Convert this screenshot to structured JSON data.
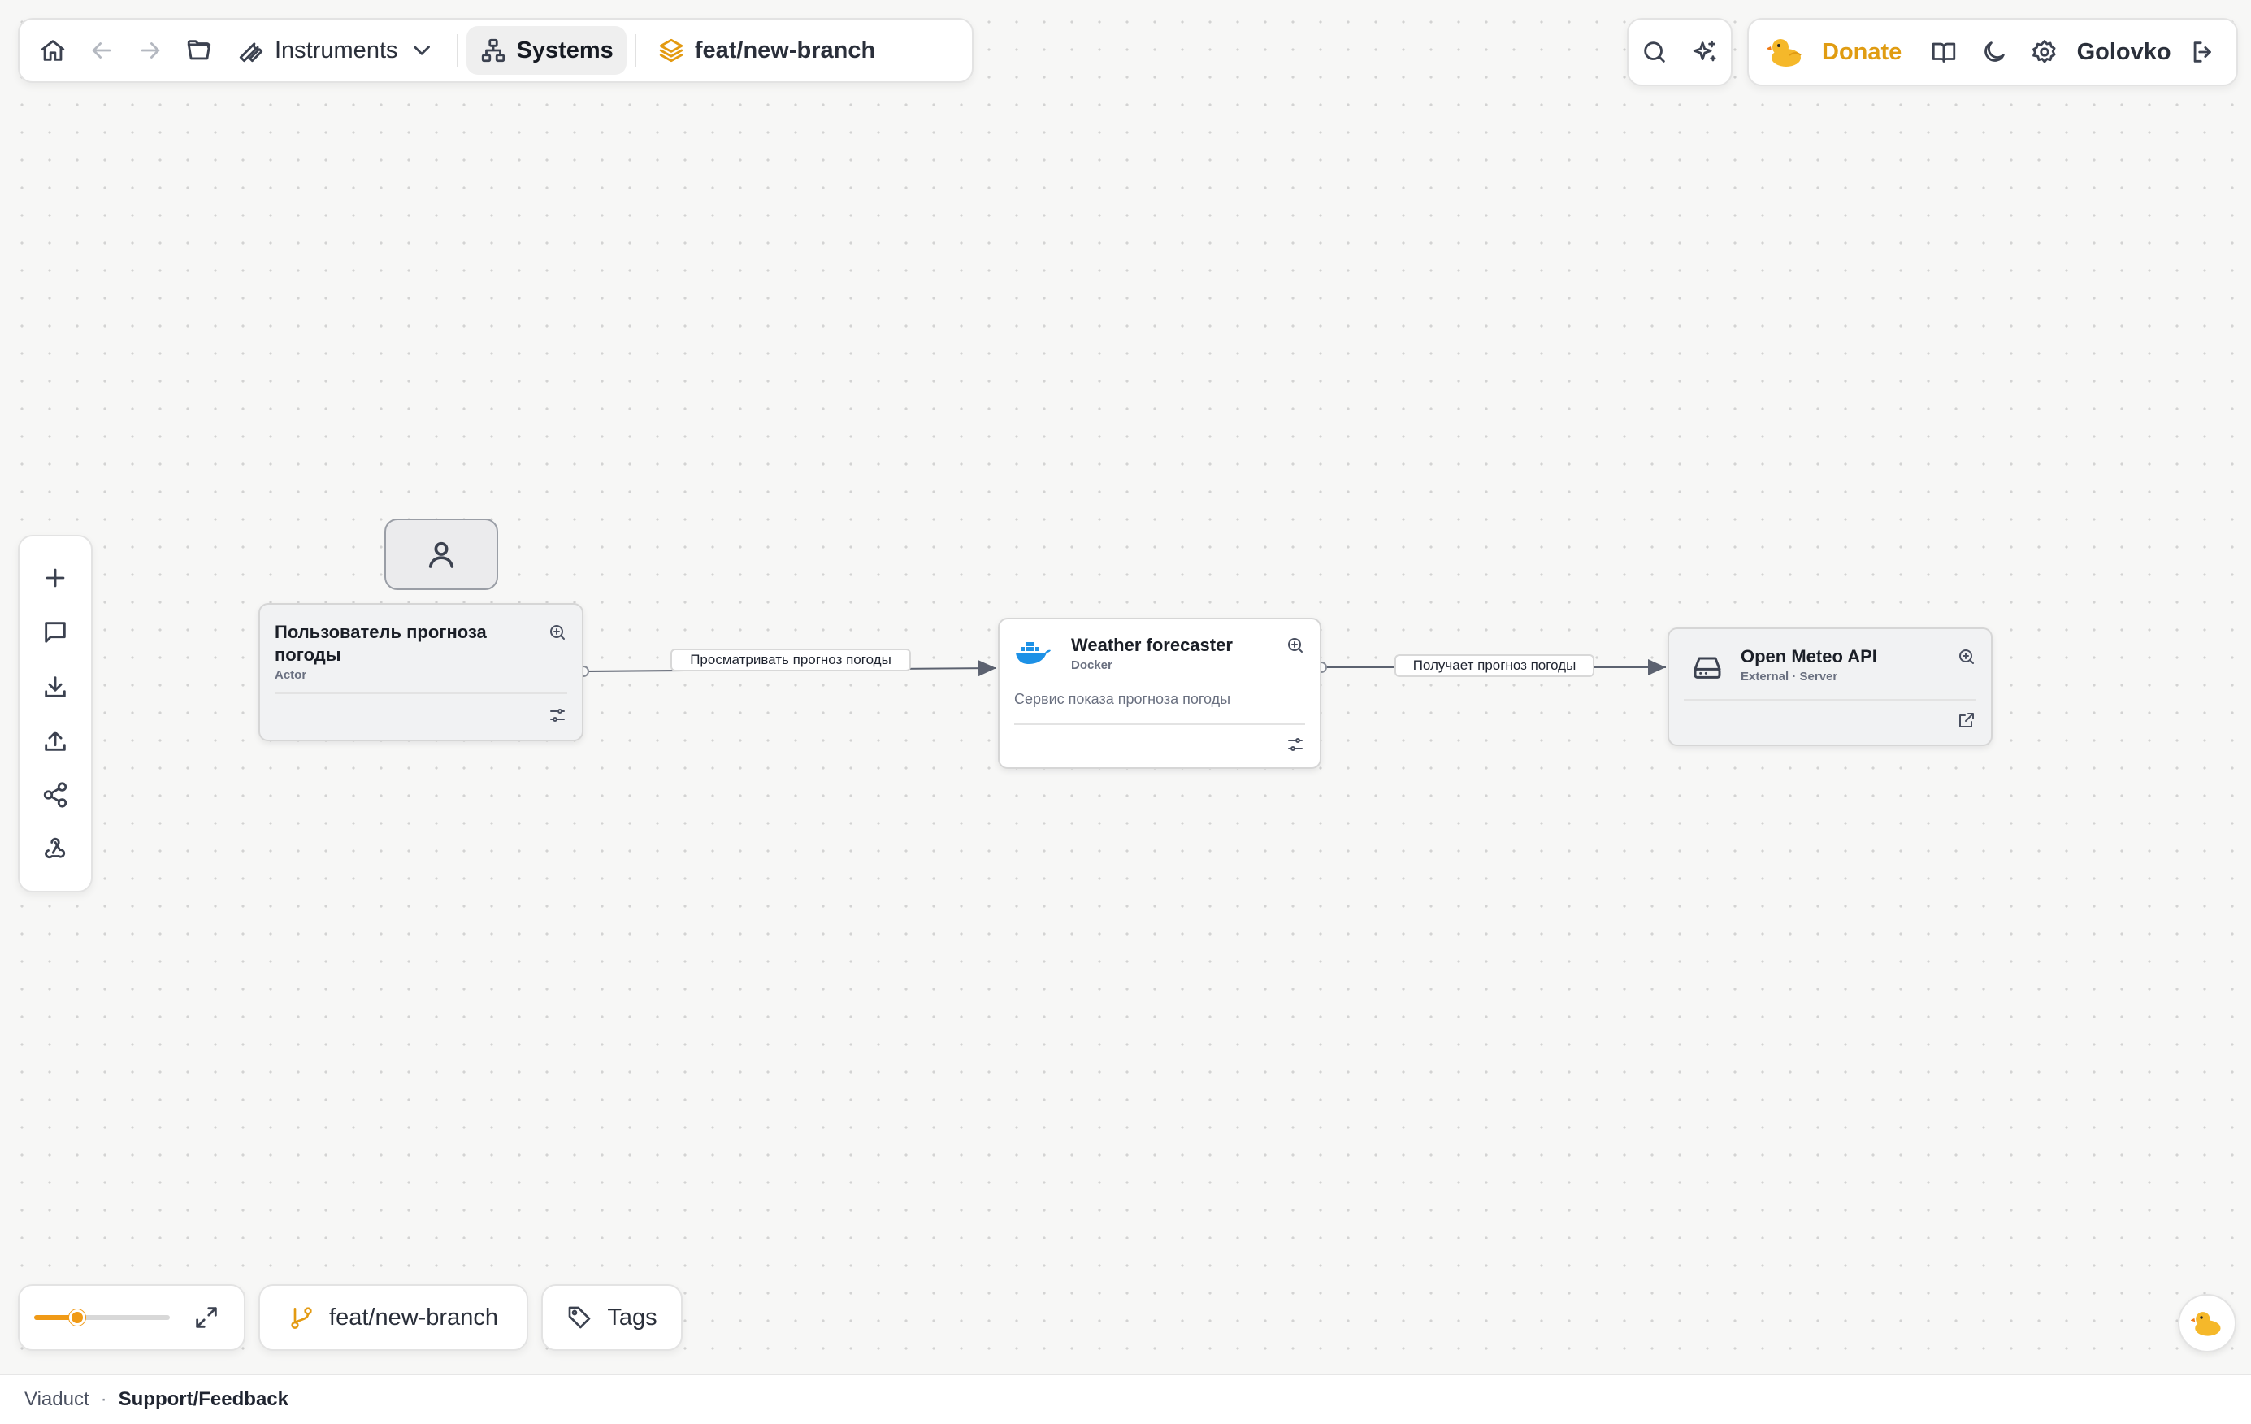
{
  "topbar": {
    "instruments_label": "Instruments",
    "systems_label": "Systems",
    "branch_label": "feat/new-branch"
  },
  "account": {
    "donate_label": "Donate",
    "user_name": "Golovko"
  },
  "diagram": {
    "nodes": [
      {
        "id": "user",
        "title": "Пользователь прогноза погоды",
        "subtitle": "Actor",
        "description": ""
      },
      {
        "id": "forecaster",
        "title": "Weather forecaster",
        "subtitle": "Docker",
        "description": "Сервис показа прогноза погоды"
      },
      {
        "id": "openmeteo",
        "title": "Open Meteo API",
        "subtitle": "External · Server",
        "description": ""
      }
    ],
    "edges": [
      {
        "from": "user",
        "to": "forecaster",
        "label": "Просматривать прогноз погоды"
      },
      {
        "from": "forecaster",
        "to": "openmeteo",
        "label": "Получает прогноз погоды"
      }
    ]
  },
  "bottom": {
    "zoom_level": 0.3,
    "branch_label": "feat/new-branch",
    "tags_label": "Tags"
  },
  "footer": {
    "brand": "Viaduct",
    "separator": "·",
    "support_link": "Support/Feedback"
  },
  "colors": {
    "accent": "#f09a16",
    "donate": "#e09c12",
    "docker_blue": "#1d91e6"
  },
  "icons": [
    "home-icon",
    "arrow-left-icon",
    "arrow-right-icon",
    "folder-icon",
    "wrench-icon",
    "chevron-down-icon",
    "sitemap-icon",
    "layers-icon",
    "search-icon",
    "sparkles-icon",
    "duck-icon",
    "book-icon",
    "moon-icon",
    "gear-icon",
    "logout-icon",
    "plus-icon",
    "comment-icon",
    "download-icon",
    "upload-icon",
    "share-icon",
    "webhook-icon",
    "user-icon",
    "zoom-in-icon",
    "settings-sliders-icon",
    "docker-icon",
    "server-icon",
    "external-link-icon",
    "expand-icon",
    "git-branch-icon",
    "tag-icon"
  ]
}
